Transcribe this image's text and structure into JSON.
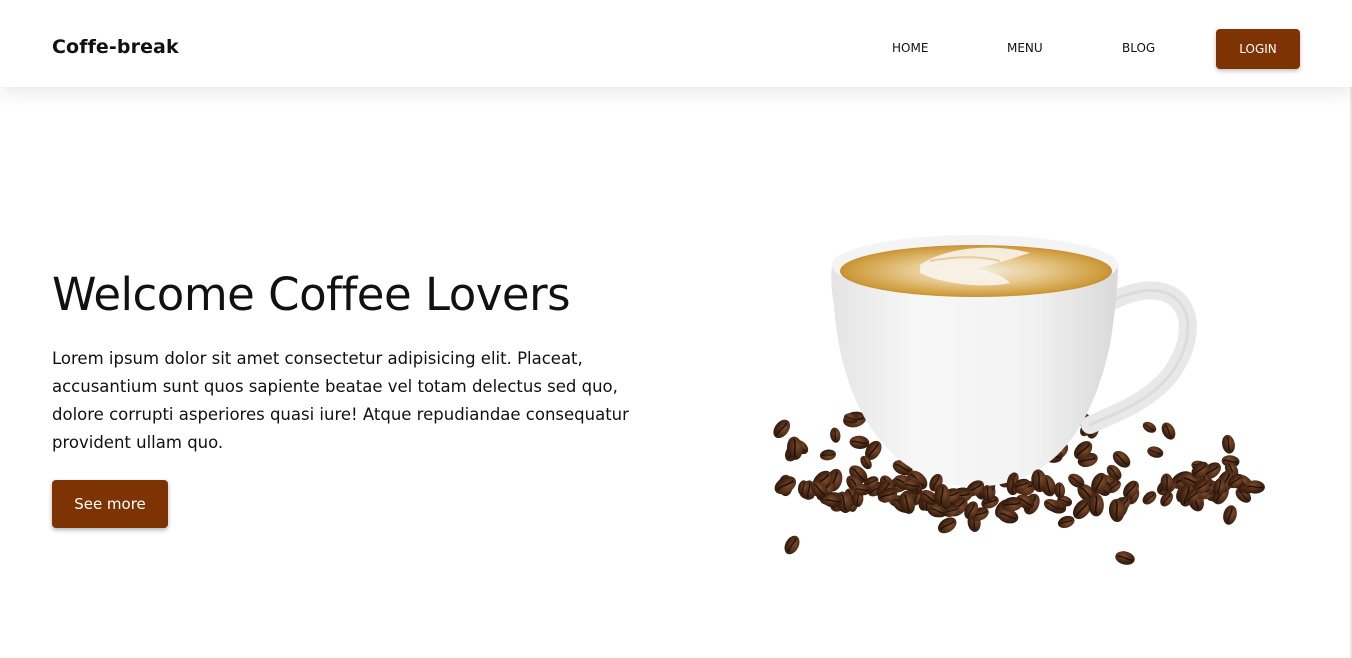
{
  "header": {
    "brand": "Coffe-break",
    "nav": [
      "HOME",
      "MENU",
      "BLOG"
    ],
    "login_label": "LOGIN"
  },
  "hero": {
    "title": "Welcome Coffee Lovers",
    "description": "Lorem ipsum dolor sit amet consectetur adipisicing elit. Placeat, accusantium sunt quos sapiente beatae vel totam delectus sed quo, dolore corrupti asperiores quasi iure! Atque repudiandae consequatur provident ullam quo.",
    "button_label": "See more",
    "image_subject": "coffee-cup-with-beans"
  },
  "colors": {
    "accent": "#7d3304",
    "background": "#ffffff",
    "text": "#111111"
  }
}
